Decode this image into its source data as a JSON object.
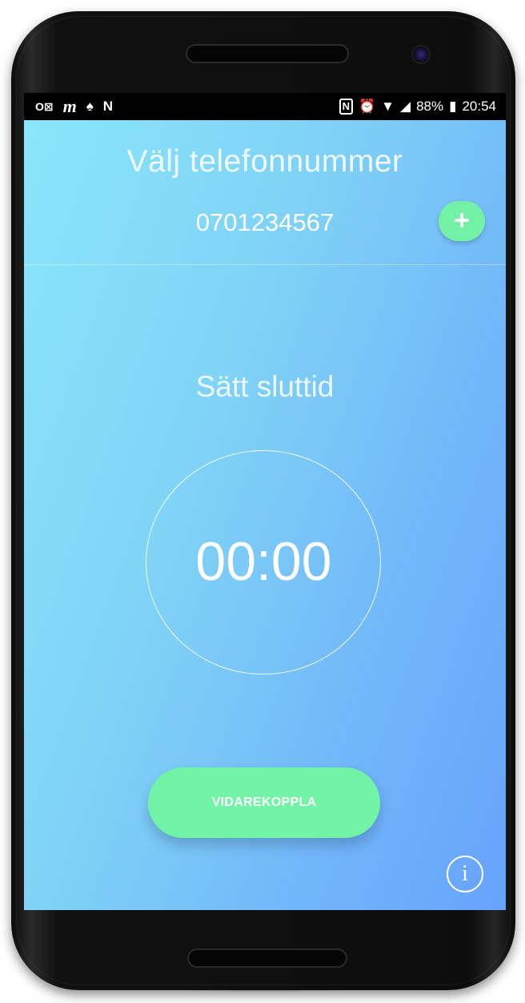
{
  "status_bar": {
    "left_icons": [
      "outlook-icon",
      "m-app-icon",
      "snapchat-icon",
      "n-app-icon"
    ],
    "left_glyphs": [
      "O⊠",
      "m",
      "♠",
      "N"
    ],
    "right_icons": [
      "nfc-icon",
      "alarm-icon",
      "wifi-icon",
      "signal-icon",
      "battery-icon"
    ],
    "nfc_glyph": "N",
    "alarm_glyph": "⏰",
    "wifi_glyph": "▼",
    "signal_glyph": "◢",
    "battery_percent": "88%",
    "battery_glyph": "▮",
    "time": "20:54"
  },
  "app": {
    "title": "Välj telefonnummer",
    "phone_number": "0701234567",
    "add_button_glyph": "+",
    "subtitle": "Sätt sluttid",
    "timer": "00:00",
    "forward_button_label": "VIDAREKOPPLA",
    "info_glyph": "i"
  },
  "colors": {
    "gradient_start": "#8ae6fb",
    "gradient_end": "#66a3fb",
    "accent_green": "#72f4a6"
  }
}
